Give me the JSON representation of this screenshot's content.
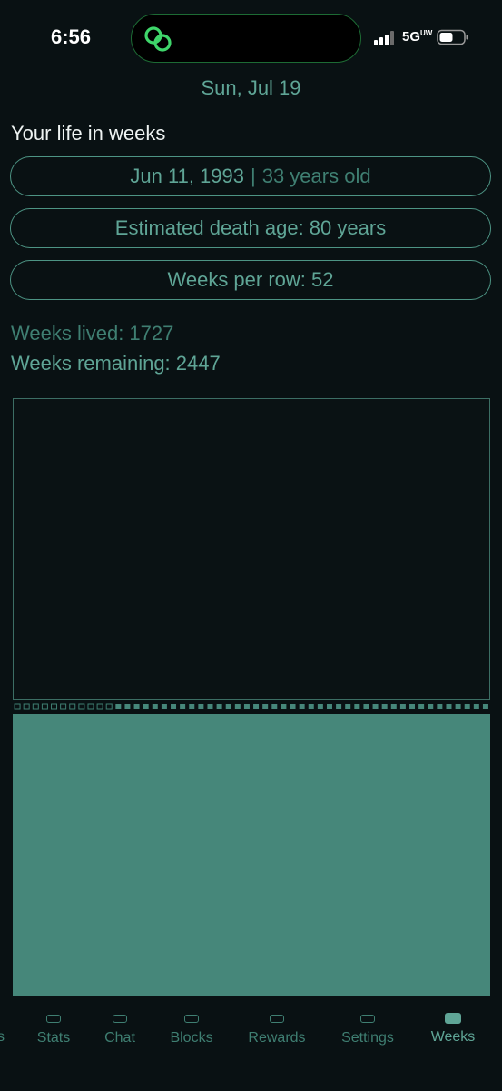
{
  "status_bar": {
    "time": "6:56",
    "network": "5G",
    "network_suffix": "UW",
    "island_icon": "link-icon",
    "signal_icon": "cellular-signal-icon",
    "battery_icon": "battery-icon"
  },
  "header": {
    "date": "Sun, Jul 19"
  },
  "life": {
    "title": "Your life in weeks",
    "birth_date": "Jun 11, 1993",
    "separator": "|",
    "age": "33 years old",
    "death_age_label": "Estimated death age: 80 years",
    "weeks_per_row_label": "Weeks per row: 52",
    "weeks_lived_label": "Weeks lived: 1727",
    "weeks_remaining_label": "Weeks remaining: 2447",
    "weeks_per_row": 52,
    "weeks_lived": 1727,
    "weeks_remaining": 2447
  },
  "tabbar": {
    "partial_label": "s",
    "tabs": [
      {
        "label": "Stats",
        "icon": "tab-icon"
      },
      {
        "label": "Chat",
        "icon": "tab-icon"
      },
      {
        "label": "Blocks",
        "icon": "tab-icon"
      },
      {
        "label": "Rewards",
        "icon": "tab-icon"
      },
      {
        "label": "Settings",
        "icon": "tab-icon"
      },
      {
        "label": "Weeks",
        "icon": "tab-icon",
        "active": true
      }
    ]
  },
  "colors": {
    "background": "#091113",
    "accent": "#5fa596",
    "accent_dim": "#3f7f72",
    "remaining_fill": "#46877a"
  }
}
